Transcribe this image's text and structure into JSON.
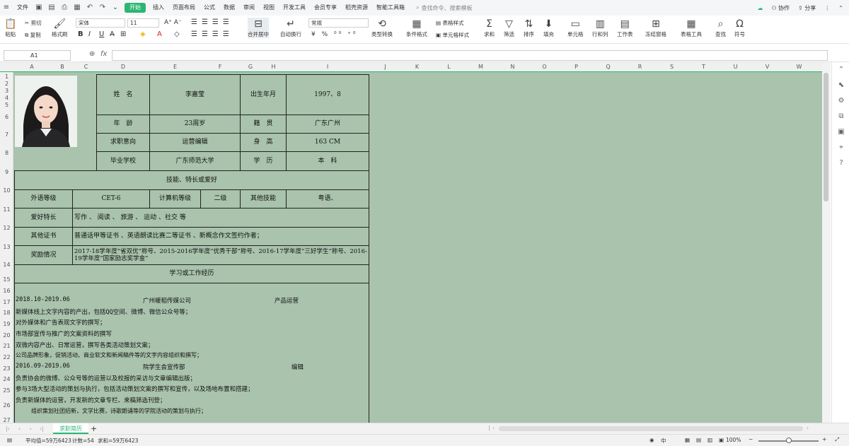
{
  "menu": {
    "file": "文件",
    "start": "开始",
    "tabs": [
      "插入",
      "页面布局",
      "公式",
      "数据",
      "审阅",
      "视图",
      "开发工具",
      "会员专享",
      "稻壳资源",
      "智能工具箱"
    ],
    "search_placeholder": "查找命令、搜索模板",
    "collab": "协作",
    "share": "分享"
  },
  "ribbon": {
    "paste": "粘贴",
    "cut": "剪切",
    "copy": "复制",
    "format_painter": "格式刷",
    "font_name": "宋体",
    "font_size": "11",
    "merge": "合并居中",
    "wrap": "自动换行",
    "number_format": "常规",
    "type_convert": "类型转换",
    "cond_format": "条件格式",
    "table_style": "表格样式",
    "cell_style": "单元格样式",
    "sum": "求和",
    "filter": "筛选",
    "sort": "排序",
    "fill": "填充",
    "cell": "单元格",
    "rowcol": "行和列",
    "worksheet": "工作表",
    "freeze": "冻结窗格",
    "table_tools": "表格工具",
    "find": "查找",
    "symbol": "符号"
  },
  "formula_bar": {
    "name_box": "A1",
    "fx": "fx",
    "value": ""
  },
  "columns": [
    "A",
    "B",
    "C",
    "D",
    "E",
    "F",
    "G",
    "H",
    "I",
    "J",
    "K",
    "L",
    "M",
    "N",
    "O",
    "P",
    "Q",
    "R",
    "S",
    "T",
    "U",
    "V",
    "W"
  ],
  "rows": [
    "1",
    "2",
    "3",
    "4",
    "5",
    "6",
    "7",
    "8",
    "9",
    "10",
    "11",
    "12",
    "13",
    "14",
    "15",
    "16",
    "17",
    "18",
    "19",
    "20",
    "21",
    "22",
    "23",
    "24",
    "25",
    "26",
    "27"
  ],
  "resume": {
    "name_label": "姓　名",
    "name": "李嘉莹",
    "birth_label": "出生年月",
    "birth": "1997、8",
    "age_label": "年　龄",
    "age": "23周岁",
    "native_label": "籍　贯",
    "native": "广东广州",
    "intent_label": "求职意向",
    "intent": "运营编辑",
    "height_label": "身　高",
    "height": "163 CM",
    "school_label": "毕业学校",
    "school": "广东师范大学",
    "degree_label": "学　历",
    "degree": "本　科",
    "skills_title": "技能、特长或爱好",
    "lang_label": "外语等级",
    "lang": "CET-6",
    "computer_label": "计算机等级",
    "computer": "二级",
    "other_skill_label": "其他技能",
    "other_skill": "粤语、",
    "hobby_label": "爱好特长",
    "hobby": "写作 、 阅读 、 旅游 、 运动 、社交 等",
    "cert_label": "其他证书",
    "cert": "普通话甲等证书 、英语朗读比赛二等证书 、新概念作文签约作者；",
    "award_label": "奖励情况",
    "award": "2017-18学年度“省双优”称号、2015-2016学年度“优秀干部”称号、2016-17学年度“三好学生”称号、2016-19学年度“国家励志奖学金”",
    "exp_title": "学习或工作经历",
    "job1_date": "2018.10-2019.06",
    "job1_company": "广州暖稻传媒公司",
    "job1_role": "产品运营",
    "job1_lines": [
      "新媒体线上文字内容的产出，包括QQ空间、微博、微信公众号等；",
      "对外媒体和广告表现文字的撰写；",
      "市场部宣传与推广的文案资料的撰写",
      "双微内容产出、日常运营，撰写各类活动策划文案；",
      "公司品牌形象，促销活动、商业软文和新闻稿件等的文字内容组织和撰写；"
    ],
    "job2_date": "2016.09-2019.06",
    "job2_company": "院学生会宣传部",
    "job2_role": "编辑",
    "job2_lines": [
      "负责协会的微博、公众号等的运营以及校报的采访与文章编辑出版；",
      "参与3场大型活动的策划与执行，包括活动策划文案的撰写和宣传，以及场地布置和搭建；",
      "负责新媒体的运营，开发新的文章专栏、来稿筛选刊登；",
      "组织策划社团招新，文学比赛，诗歌朗诵等的学院活动的策划与执行；"
    ]
  },
  "sheet_tab": "求职简历",
  "status": {
    "average": "平均值=59万6423",
    "count": "计数=54",
    "sum": "求和=59万6423",
    "zoom": "100%"
  },
  "colors": {
    "accent": "#2bb673",
    "sheet_bg": "#a9c3ac",
    "photo_bg": "#d8eedb"
  }
}
